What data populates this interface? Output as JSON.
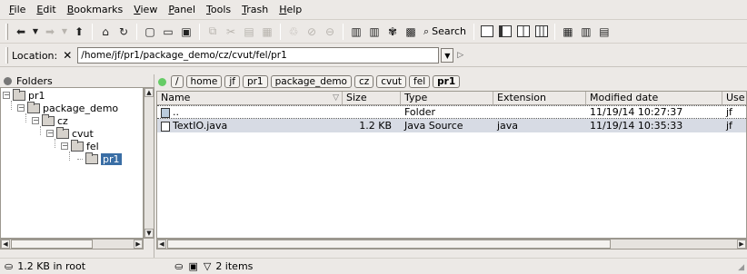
{
  "menu": [
    {
      "key": "F",
      "rest": "ile"
    },
    {
      "key": "E",
      "rest": "dit"
    },
    {
      "key": "B",
      "rest": "ookmarks"
    },
    {
      "key": "V",
      "rest": "iew"
    },
    {
      "key": "P",
      "rest": "anel"
    },
    {
      "key": "T",
      "rest": "ools"
    },
    {
      "key": "T",
      "rest": "rash"
    },
    {
      "key": "H",
      "rest": "elp"
    }
  ],
  "toolbar": {
    "search_label": "Search"
  },
  "location": {
    "label": "Location:",
    "value": "/home/jf/pr1/package_demo/cz/cvut/fel/pr1"
  },
  "folders_panel": {
    "title": "Folders",
    "tree": [
      "pr1",
      "package_demo",
      "cz",
      "cvut",
      "fel",
      "pr1"
    ]
  },
  "breadcrumbs": [
    "/",
    "home",
    "jf",
    "pr1",
    "package_demo",
    "cz",
    "cvut",
    "fel",
    "pr1"
  ],
  "columns": [
    "Name",
    "Size",
    "Type",
    "Extension",
    "Modified date",
    "Use"
  ],
  "files": [
    {
      "name": "..",
      "size": "",
      "type": "Folder",
      "ext": "",
      "modified": "11/19/14 10:27:37",
      "user": "jf"
    },
    {
      "name": "TextIO.java",
      "size": "1.2 KB",
      "type": "Java Source",
      "ext": "java",
      "modified": "11/19/14 10:35:33",
      "user": "jf"
    }
  ],
  "status": {
    "left": "1.2 KB in root",
    "right": "2 items"
  },
  "colors": {
    "selection": "#3a6ea5",
    "row_highlight": "#d7dbe4"
  }
}
